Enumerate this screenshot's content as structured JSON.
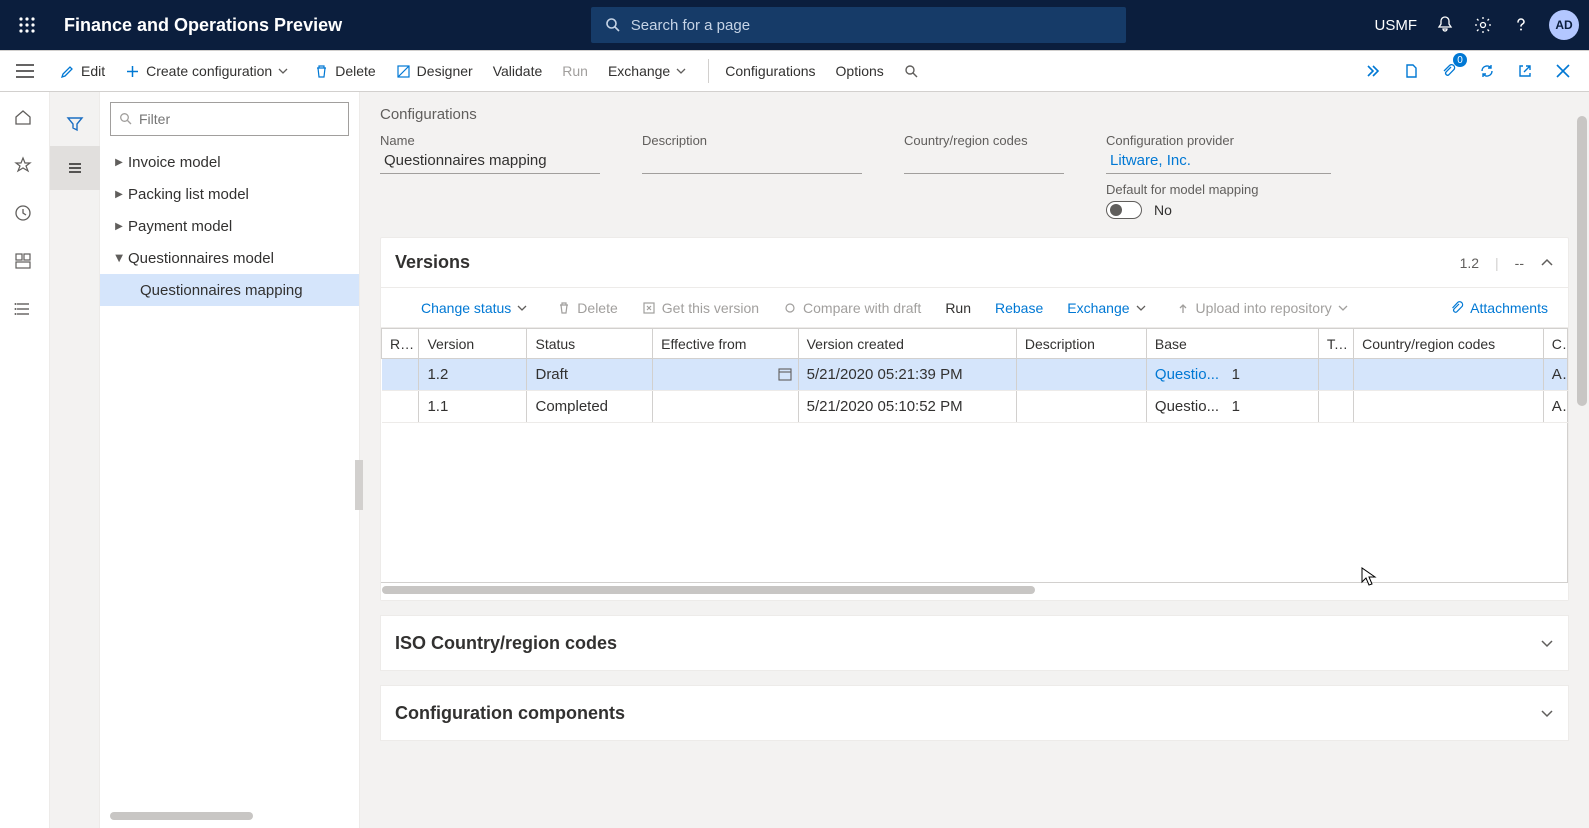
{
  "topnav": {
    "app_title": "Finance and Operations Preview",
    "search_placeholder": "Search for a page",
    "company": "USMF",
    "avatar_initials": "AD"
  },
  "actionbar": {
    "edit": "Edit",
    "create": "Create configuration",
    "delete": "Delete",
    "designer": "Designer",
    "validate": "Validate",
    "run": "Run",
    "exchange": "Exchange",
    "configurations": "Configurations",
    "options": "Options",
    "attachments_count": "0"
  },
  "tree": {
    "filter_placeholder": "Filter",
    "items": [
      {
        "label": "Invoice model",
        "expanded": false
      },
      {
        "label": "Packing list model",
        "expanded": false
      },
      {
        "label": "Payment model",
        "expanded": false
      },
      {
        "label": "Questionnaires model",
        "expanded": true,
        "children": [
          {
            "label": "Questionnaires mapping",
            "selected": true
          }
        ]
      }
    ]
  },
  "page": {
    "crumb": "Configurations",
    "name_label": "Name",
    "name_value": "Questionnaires mapping",
    "description_label": "Description",
    "description_value": "",
    "country_label": "Country/region codes",
    "country_value": "",
    "provider_label": "Configuration provider",
    "provider_value": "Litware, Inc.",
    "default_mapping_label": "Default for model mapping",
    "default_mapping_value": "No"
  },
  "versions": {
    "title": "Versions",
    "summary_version": "1.2",
    "summary_extra": "--",
    "toolbar": {
      "change_status": "Change status",
      "delete": "Delete",
      "get": "Get this version",
      "compare": "Compare with draft",
      "run": "Run",
      "rebase": "Rebase",
      "exchange": "Exchange",
      "upload": "Upload into repository",
      "attachments": "Attachments"
    },
    "columns": {
      "r": "R...",
      "version": "Version",
      "status": "Status",
      "effective": "Effective from",
      "created": "Version created",
      "description": "Description",
      "base": "Base",
      "t": "T...",
      "country": "Country/region codes",
      "cc": "C"
    },
    "rows": [
      {
        "r": "",
        "version": "1.2",
        "status": "Draft",
        "effective": "",
        "created": "5/21/2020 05:21:39 PM",
        "description": "",
        "base": "Questio...",
        "base_n": "1",
        "t": "",
        "country": "",
        "cc": "A",
        "selected": true
      },
      {
        "r": "",
        "version": "1.1",
        "status": "Completed",
        "effective": "",
        "created": "5/21/2020 05:10:52 PM",
        "description": "",
        "base": "Questio...",
        "base_n": "1",
        "t": "",
        "country": "",
        "cc": "A",
        "selected": false
      }
    ]
  },
  "sections": {
    "iso": "ISO Country/region codes",
    "components": "Configuration components"
  }
}
